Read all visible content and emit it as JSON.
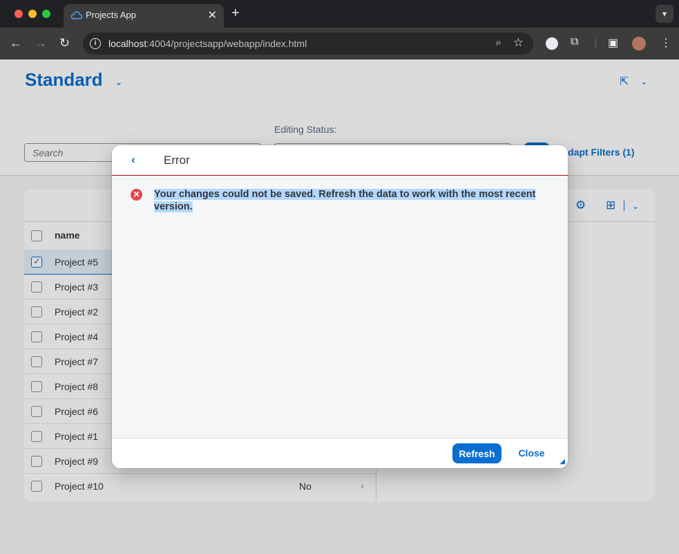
{
  "browser": {
    "tab_title": "Projects App",
    "tab_close": "✕",
    "new_tab": "+",
    "url_host": "localhost",
    "url_rest": ":4004/projectsapp/webapp/index.html"
  },
  "header": {
    "variant_title": "Standard",
    "editing_status_label": "Editing Status:",
    "search_placeholder": "Search",
    "adapt_filters": "Adapt Filters (1)"
  },
  "table": {
    "column_name": "name",
    "rows": [
      {
        "name": "Project #5",
        "status": ""
      },
      {
        "name": "Project #3",
        "status": ""
      },
      {
        "name": "Project #2",
        "status": ""
      },
      {
        "name": "Project #4",
        "status": ""
      },
      {
        "name": "Project #7",
        "status": ""
      },
      {
        "name": "Project #8",
        "status": ""
      },
      {
        "name": "Project #6",
        "status": ""
      },
      {
        "name": "Project #1",
        "status": ""
      },
      {
        "name": "Project #9",
        "status": ""
      },
      {
        "name": "Project #10",
        "status": "No"
      }
    ]
  },
  "dialog": {
    "title": "Error",
    "message": "Your changes could not be saved. Refresh the data to work with the most recent version.",
    "refresh_label": "Refresh",
    "close_label": "Close"
  },
  "colors": {
    "accent": "#0a6ed1",
    "error": "#e5484d",
    "error_line": "#bb0000"
  }
}
